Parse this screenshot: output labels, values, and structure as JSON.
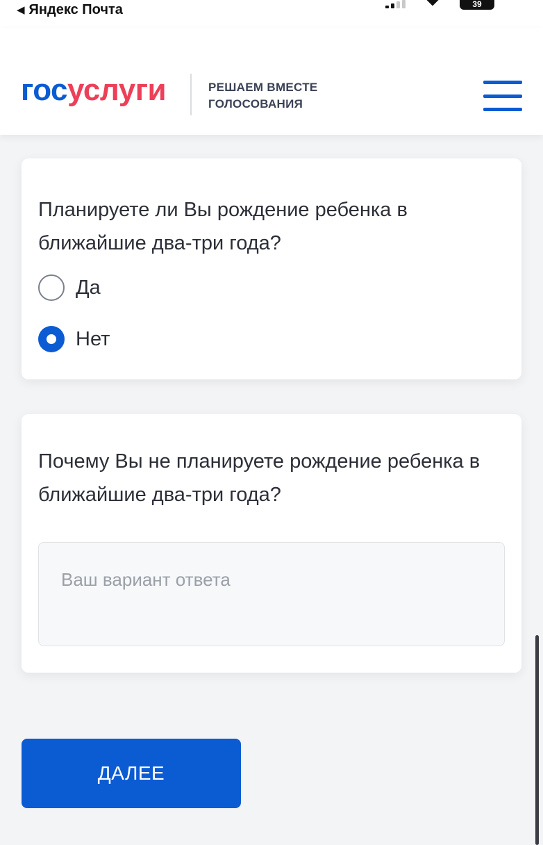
{
  "status_bar": {
    "back_arrow": "◀",
    "back_app": "Яндекс Почта",
    "battery": "39"
  },
  "header": {
    "logo_part1": "гос",
    "logo_part2": "услуги",
    "tagline_line1": "РЕШАЕМ ВМЕСТЕ",
    "tagline_line2": "ГОЛОСОВАНИЯ",
    "menu_icon": "hamburger-menu-icon",
    "colors": {
      "brand_blue": "#0b5bd3",
      "brand_red": "#ee3f58"
    }
  },
  "question1": {
    "text": "Планируете ли Вы рождение ребенка в ближайшие два-три года?",
    "options": [
      {
        "label": "Да",
        "checked": false
      },
      {
        "label": "Нет",
        "checked": true
      }
    ]
  },
  "question2": {
    "text": "Почему Вы не планируете рождение ребенка в ближайшие два-три года?",
    "answer_value": "",
    "answer_placeholder": "Ваш вариант ответа"
  },
  "actions": {
    "next_label": "ДАЛЕЕ"
  }
}
